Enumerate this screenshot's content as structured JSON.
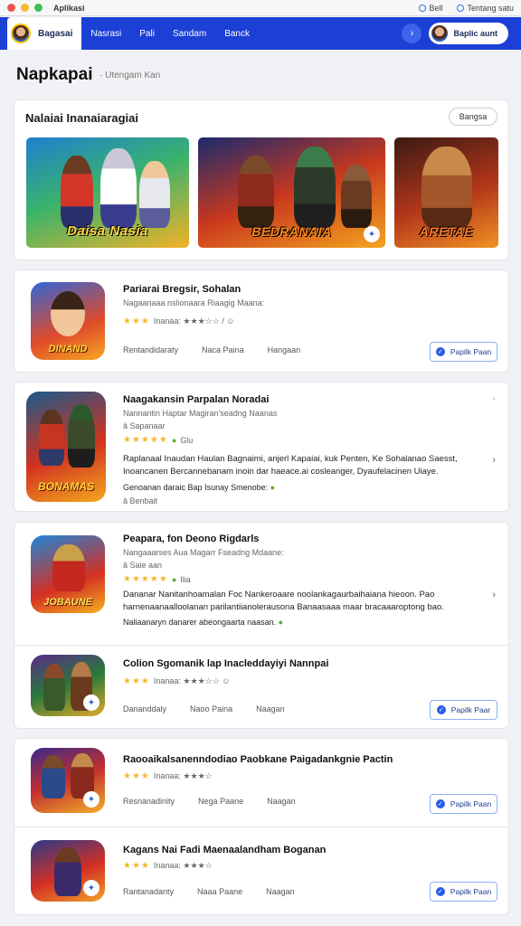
{
  "window": {
    "title": "Aplikasi",
    "right_items": [
      "Bell",
      "Tentang satu"
    ]
  },
  "nav": {
    "active": "Bagasai",
    "items": [
      "Nasrasi",
      "Pali",
      "Sandam",
      "Banck"
    ],
    "signin_label": "Baplic aunt"
  },
  "page": {
    "title": "Napkapai",
    "subtitle": "Utengam Kan"
  },
  "featured": {
    "title": "Nalaiai Inanaiaragiai",
    "button": "Bangsa",
    "banners": [
      {
        "label": "Daisa Nasia",
        "bg": "#2aa86b"
      },
      {
        "label": "BEDRANAIA",
        "bg": "#e8531c"
      },
      {
        "label": "ARETAE",
        "bg": "#f07a1c"
      }
    ]
  },
  "apps": [
    {
      "name": "Pariarai Bregsir, Sohalan",
      "meta": "Nagaanaaa nslionaara Riaagig Maana:",
      "stars": 3,
      "rating_text": "Inanaa: ★★★☆☆ / ☺",
      "tags": [
        "Rentandidaraty",
        "Naca Paina",
        "Hangaan"
      ],
      "button": "Papilk Paan",
      "icon_label": "DINAND"
    },
    {
      "name": "Naagakansin Parpalan Noradai",
      "meta": "Nannantin Haptar Magiran'seadng Naanas",
      "meta2": "Sapanaar",
      "rating_text": "Glu",
      "desc": "Raplanaal Inaudan Haulan Bagnaimi, anjerl Kapaiai, kuk Penten, Ke Sohalanao Saesst, Inoancanen Bercannebanam inoin dar haeace.ai cosleanger, Dyaufelacinen Uiaye.",
      "desc2": "Genoanan daraic Bap Isunay Smenobe:",
      "foot": "Benbait",
      "icon_label": "BONAMAS"
    },
    {
      "name": "Peapara, fon Deono Rigdarls",
      "meta": "Nangaaarses Aua Magarr Fseadng Mdaane:",
      "meta2": "Saie aan",
      "rating_text": "Ilia",
      "desc": "Dananar Nanitanhoamalan Foc Nankeroaare noolankagaurbaihaiana hieoon. Pao harnenaanaalloolanan parilantiianolerausona Banaasaaa maar bracaaaroptong bao.",
      "desc2": "Naliaanaryn danarer abeongaarta naasan.",
      "icon_label": "JOBAUNE"
    },
    {
      "name": "Colion Sgomanik lap Inacleddayiyi Nannpai",
      "stars": 3,
      "rating_text": "Inanaa: ★★★☆☆ ☺",
      "tags": [
        "Dananddaly",
        "Naoo Paina",
        "Naagan"
      ],
      "button": "Papilk Paar"
    },
    {
      "name": "Raooaikalsanenndodiao Paobkane Paigadankgnie Pactin",
      "stars": 3,
      "rating_text": "Inanaa: ★★★☆",
      "tags": [
        "Resnanadinity",
        "Nega Paane",
        "Naagan"
      ],
      "button": "Papilk Paan"
    },
    {
      "name": "Kagans Nai Fadi Maenaalandham Boganan",
      "stars": 3,
      "rating_text": "Inanaa: ★★★☆",
      "tags": [
        "Rantanadanty",
        "Naaa Paane",
        "Naagan"
      ],
      "button": "Papilk Paan"
    }
  ]
}
